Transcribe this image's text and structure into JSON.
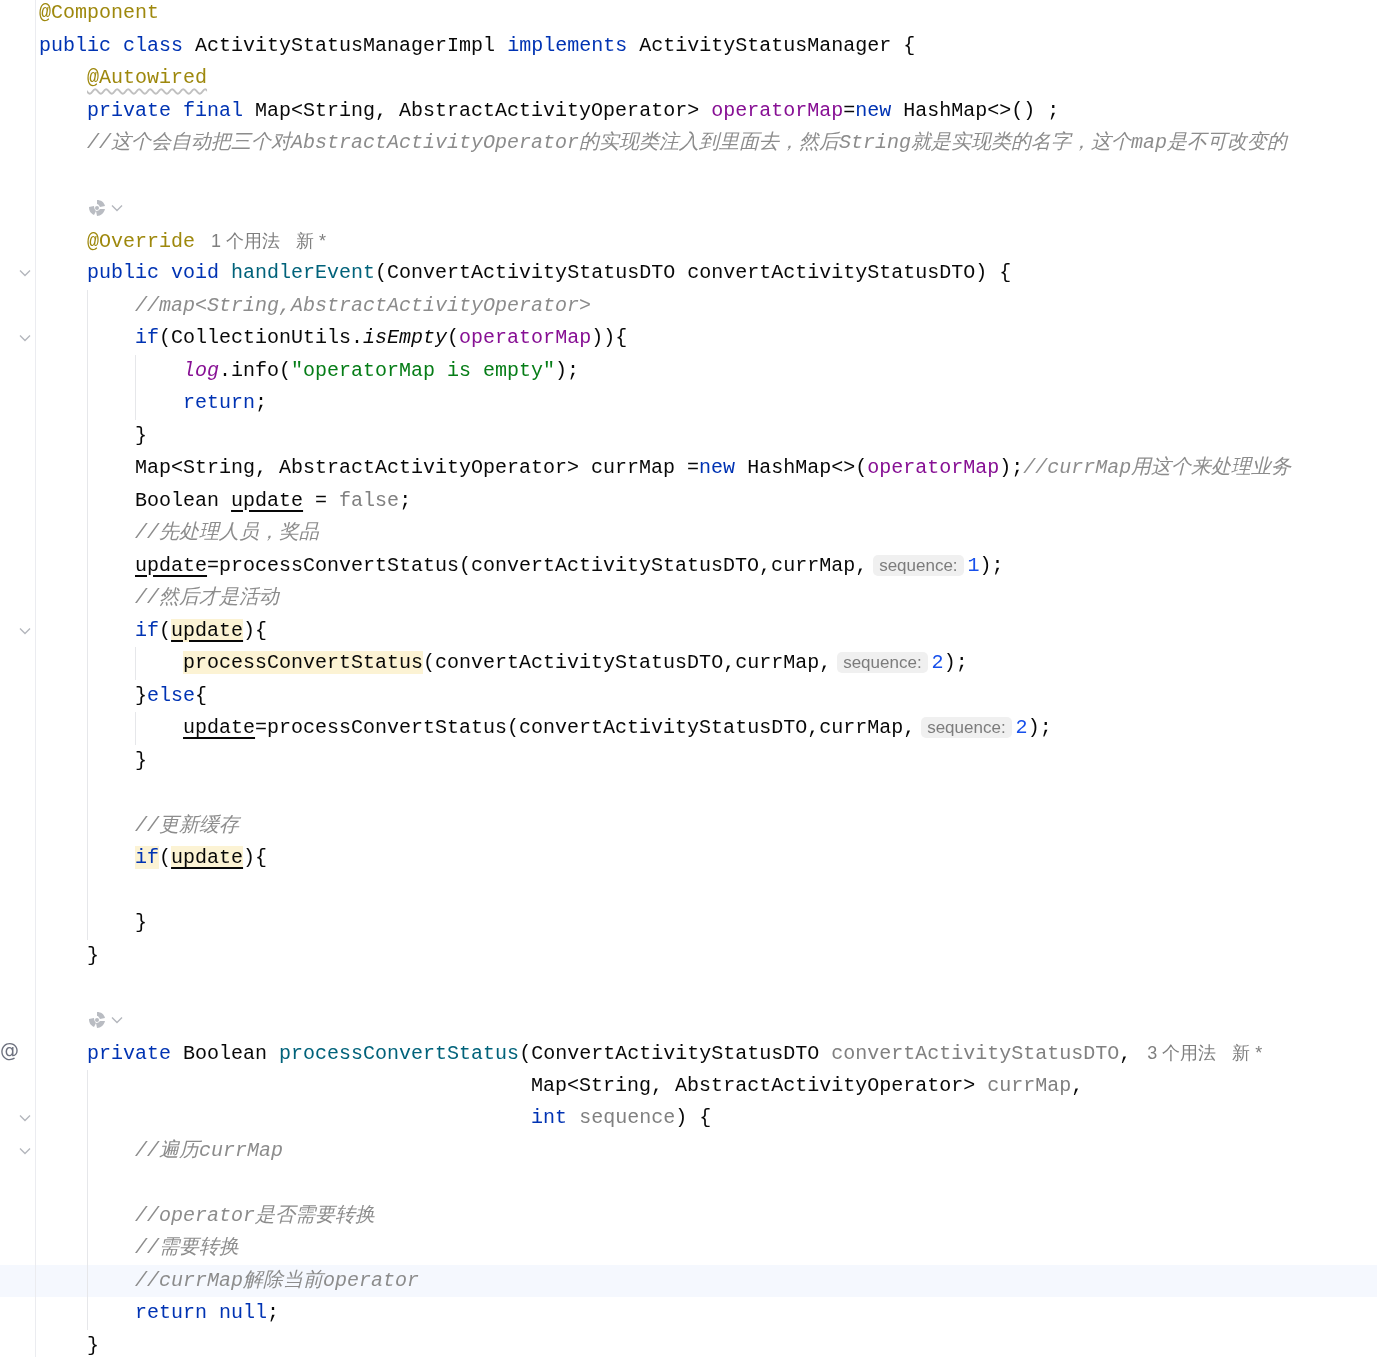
{
  "editor": {
    "lines": [
      {
        "tokens": [
          {
            "text": "@Component",
            "kind": "annotation"
          }
        ]
      },
      {
        "tokens": [
          {
            "text": "public class",
            "kind": "keyword"
          },
          {
            "text": " ActivityStatusManagerImpl ",
            "kind": "plain"
          },
          {
            "text": "implements",
            "kind": "keyword"
          },
          {
            "text": " ActivityStatusManager {",
            "kind": "plain"
          }
        ]
      },
      {
        "tokens": [
          {
            "text": "    @Autowired",
            "kind": "annotation",
            "wavy": true
          }
        ]
      },
      {
        "tokens": [
          {
            "text": "    private final",
            "kind": "keyword"
          },
          {
            "text": " Map<String, AbstractActivityOperator> ",
            "kind": "plain"
          },
          {
            "text": "operatorMap",
            "kind": "field"
          },
          {
            "text": "=",
            "kind": "plain"
          },
          {
            "text": "new",
            "kind": "keyword"
          },
          {
            "text": " HashMap<>() ;",
            "kind": "plain"
          }
        ]
      },
      {
        "tokens": [
          {
            "text": "    //这个会自动把三个对AbstractActivityOperator的实现类注入到里面去，然后String就是实现类的名字，这个map是不可改变的",
            "kind": "comment"
          }
        ]
      },
      {
        "kind": "blank"
      },
      {
        "kind": "icons"
      },
      {
        "tokens": [
          {
            "text": "    @Override",
            "kind": "annotation"
          },
          {
            "text": "1 个用法",
            "kind": "usage"
          },
          {
            "text": "新 *",
            "kind": "usage"
          }
        ]
      },
      {
        "fold": true,
        "tokens": [
          {
            "text": "    public void",
            "kind": "keyword"
          },
          {
            "text": " handlerEvent",
            "kind": "method"
          },
          {
            "text": "(ConvertActivityStatusDTO convertActivityStatusDTO) {",
            "kind": "plain"
          }
        ]
      },
      {
        "tokens": [
          {
            "text": "        //map<String,AbstractActivityOperator>",
            "kind": "comment"
          }
        ]
      },
      {
        "fold": true,
        "tokens": [
          {
            "text": "        if",
            "kind": "keyword"
          },
          {
            "text": "(CollectionUtils.",
            "kind": "plain"
          },
          {
            "text": "isEmpty",
            "kind": "plain",
            "italic": true
          },
          {
            "text": "(",
            "kind": "plain"
          },
          {
            "text": "operatorMap",
            "kind": "field"
          },
          {
            "text": ")){",
            "kind": "plain"
          }
        ]
      },
      {
        "tokens": [
          {
            "text": "            log",
            "kind": "field",
            "italic": true
          },
          {
            "text": ".info(",
            "kind": "plain"
          },
          {
            "text": "\"operatorMap is empty\"",
            "kind": "string"
          },
          {
            "text": ");",
            "kind": "plain"
          }
        ]
      },
      {
        "tokens": [
          {
            "text": "            return",
            "kind": "keyword"
          },
          {
            "text": ";",
            "kind": "plain"
          }
        ]
      },
      {
        "tokens": [
          {
            "text": "        }",
            "kind": "plain"
          }
        ]
      },
      {
        "tokens": [
          {
            "text": "        Map<String, AbstractActivityOperator> currMap =",
            "kind": "plain"
          },
          {
            "text": "new",
            "kind": "keyword"
          },
          {
            "text": " HashMap<>(",
            "kind": "plain"
          },
          {
            "text": "operatorMap",
            "kind": "field"
          },
          {
            "text": ");",
            "kind": "plain"
          },
          {
            "text": "//currMap用这个来处理业务",
            "kind": "comment"
          }
        ]
      },
      {
        "tokens": [
          {
            "text": "        Boolean ",
            "kind": "plain"
          },
          {
            "text": "update",
            "kind": "plain",
            "underline": true
          },
          {
            "text": " = ",
            "kind": "plain"
          },
          {
            "text": "false",
            "kind": "param"
          },
          {
            "text": ";",
            "kind": "plain"
          }
        ]
      },
      {
        "tokens": [
          {
            "text": "        //先处理人员，奖品",
            "kind": "comment"
          }
        ]
      },
      {
        "tokens": [
          {
            "text": "        update",
            "kind": "plain",
            "underline": true
          },
          {
            "text": "=processConvertStatus(convertActivityStatusDTO,currMap,",
            "kind": "plain"
          },
          {
            "text": "sequence:",
            "kind": "hint"
          },
          {
            "text": "1",
            "kind": "number"
          },
          {
            "text": ");",
            "kind": "plain"
          }
        ]
      },
      {
        "tokens": [
          {
            "text": "        //然后才是活动",
            "kind": "comment"
          }
        ]
      },
      {
        "fold": true,
        "tokens": [
          {
            "text": "        if",
            "kind": "keyword"
          },
          {
            "text": "(",
            "kind": "plain"
          },
          {
            "text": "update",
            "kind": "plain",
            "underline": true,
            "highlight": true
          },
          {
            "text": "){",
            "kind": "plain"
          }
        ]
      },
      {
        "tokens": [
          {
            "text": "            processConvertStatus",
            "kind": "plain",
            "highlight": true
          },
          {
            "text": "(convertActivityStatusDTO,currMap,",
            "kind": "plain"
          },
          {
            "text": "sequence:",
            "kind": "hint"
          },
          {
            "text": "2",
            "kind": "number"
          },
          {
            "text": ");",
            "kind": "plain"
          }
        ]
      },
      {
        "tokens": [
          {
            "text": "        }",
            "kind": "plain"
          },
          {
            "text": "else",
            "kind": "keyword"
          },
          {
            "text": "{",
            "kind": "plain"
          }
        ]
      },
      {
        "tokens": [
          {
            "text": "            update",
            "kind": "plain",
            "underline": true
          },
          {
            "text": "=processConvertStatus(convertActivityStatusDTO,currMap,",
            "kind": "plain"
          },
          {
            "text": "sequence:",
            "kind": "hint"
          },
          {
            "text": "2",
            "kind": "number"
          },
          {
            "text": ");",
            "kind": "plain"
          }
        ]
      },
      {
        "tokens": [
          {
            "text": "        }",
            "kind": "plain"
          }
        ]
      },
      {
        "kind": "blank"
      },
      {
        "tokens": [
          {
            "text": "        //更新缓存",
            "kind": "comment"
          }
        ]
      },
      {
        "tokens": [
          {
            "text": "        if",
            "kind": "keyword",
            "highlight": true
          },
          {
            "text": "(",
            "kind": "plain"
          },
          {
            "text": "update",
            "kind": "plain",
            "underline": true,
            "highlight": true
          },
          {
            "text": "){",
            "kind": "plain"
          }
        ]
      },
      {
        "kind": "blank"
      },
      {
        "tokens": [
          {
            "text": "        }",
            "kind": "plain"
          }
        ]
      },
      {
        "tokens": [
          {
            "text": "    }",
            "kind": "plain"
          }
        ]
      },
      {
        "kind": "blank"
      },
      {
        "kind": "icons"
      },
      {
        "gutter_marker": "@",
        "tokens": [
          {
            "text": "    private",
            "kind": "keyword"
          },
          {
            "text": " Boolean ",
            "kind": "plain"
          },
          {
            "text": "processConvertStatus",
            "kind": "method"
          },
          {
            "text": "(ConvertActivityStatusDTO ",
            "kind": "plain"
          },
          {
            "text": "convertActivityStatusDTO",
            "kind": "param"
          },
          {
            "text": ",",
            "kind": "plain"
          },
          {
            "text": "3 个用法",
            "kind": "usage"
          },
          {
            "text": "新 *",
            "kind": "usage"
          }
        ]
      },
      {
        "tokens": [
          {
            "text": "                                         Map<String, AbstractActivityOperator> ",
            "kind": "plain"
          },
          {
            "text": "currMap",
            "kind": "param"
          },
          {
            "text": ",",
            "kind": "plain"
          }
        ]
      },
      {
        "fold": true,
        "tokens": [
          {
            "text": "                                         int",
            "kind": "keyword"
          },
          {
            "text": " sequence",
            "kind": "param"
          },
          {
            "text": ") {",
            "kind": "plain"
          }
        ]
      },
      {
        "fold": true,
        "tokens": [
          {
            "text": "        //遍历currMap",
            "kind": "comment"
          }
        ]
      },
      {
        "kind": "blank"
      },
      {
        "tokens": [
          {
            "text": "        //operator是否需要转换",
            "kind": "comment"
          }
        ]
      },
      {
        "tokens": [
          {
            "text": "        //需要转换",
            "kind": "comment"
          }
        ]
      },
      {
        "current": true,
        "tokens": [
          {
            "text": "        //currMap解除当前operator",
            "kind": "comment"
          }
        ]
      },
      {
        "tokens": [
          {
            "text": "        return null",
            "kind": "keyword"
          },
          {
            "text": ";",
            "kind": "plain"
          }
        ]
      },
      {
        "tokens": [
          {
            "text": "    }",
            "kind": "plain"
          }
        ]
      }
    ]
  }
}
